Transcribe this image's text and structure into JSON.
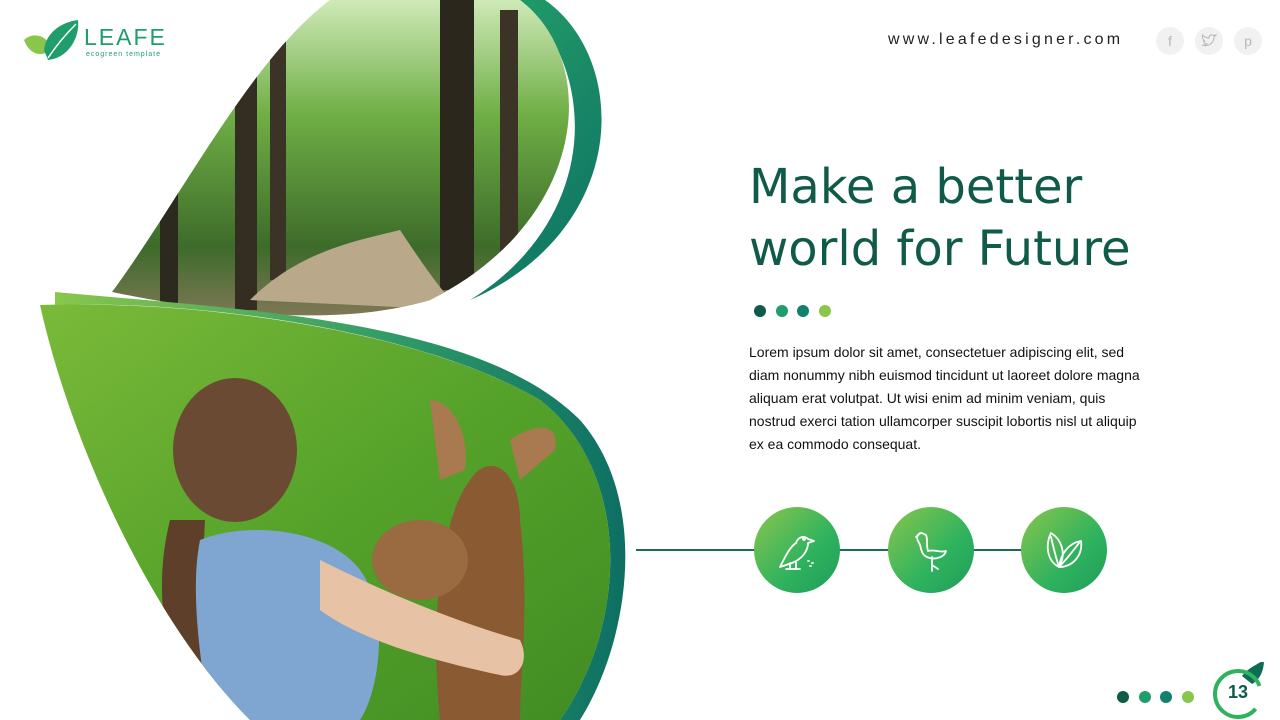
{
  "brand": {
    "name": "LEAFE",
    "tagline": "ecogreen template",
    "accent": "#1f9d6b",
    "dark_green": "#0f5a48",
    "light_green": "#8ac64c"
  },
  "header": {
    "website": "www.leafedesigner.com",
    "social": [
      {
        "icon": "facebook-icon",
        "glyph": "f"
      },
      {
        "icon": "twitter-icon",
        "glyph": "t"
      },
      {
        "icon": "pinterest-icon",
        "glyph": "p"
      }
    ]
  },
  "main": {
    "headline_line1": "Make a better",
    "headline_line2": "world for Future",
    "body": "Lorem ipsum dolor sit amet, consectetuer adipiscing elit, sed diam nonummy nibh euismod tincidunt ut laoreet dolore magna aliquam erat volutpat. Ut wisi enim ad minim veniam, quis nostrud exerci tation ullamcorper suscipit lobortis nisl ut aliquip ex ea commodo consequat.",
    "dot_colors": [
      "#0f5a48",
      "#1f9d6b",
      "#13806c",
      "#8ac64c"
    ],
    "feature_icons": [
      "bird-icon",
      "flamingo-icon",
      "leaves-icon"
    ]
  },
  "photos": {
    "top": "forest-path-photo",
    "bottom": "girl-with-deer-photo"
  },
  "footer": {
    "page_number": "13"
  }
}
